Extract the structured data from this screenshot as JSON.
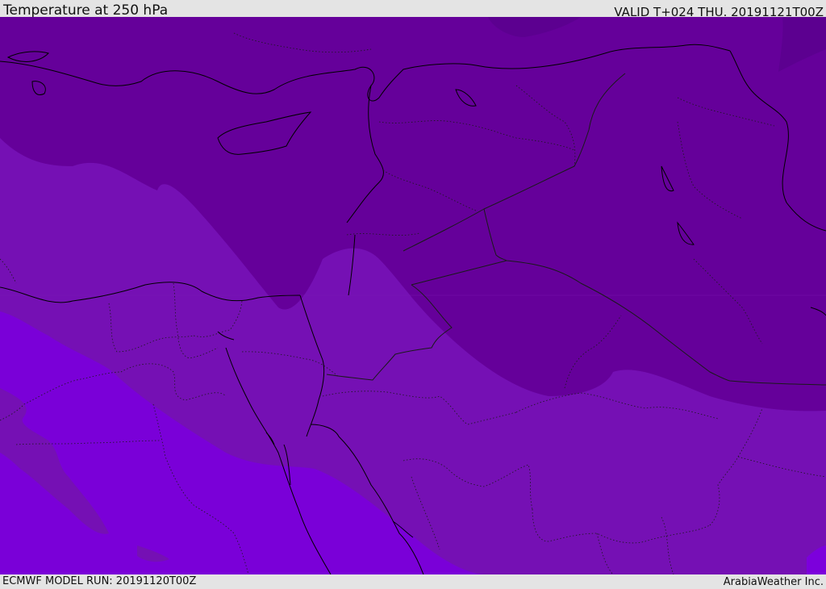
{
  "header": {
    "title": "Temperature at 250 hPa",
    "valid": "VALID T+024 THU. 20191121T00Z"
  },
  "footer": {
    "model_run": "ECMWF MODEL RUN: 20191120T00Z",
    "credit": "ArabiaWeather Inc."
  },
  "colors": {
    "band_coldest": "#5c0090",
    "band_cold": "#65009a",
    "band_mid": "#7510b4",
    "band_warm": "#7a00d8",
    "band_warm_alt": "#7c00dc",
    "coast_line": "#000000",
    "border_line": "#1a1a1a"
  }
}
